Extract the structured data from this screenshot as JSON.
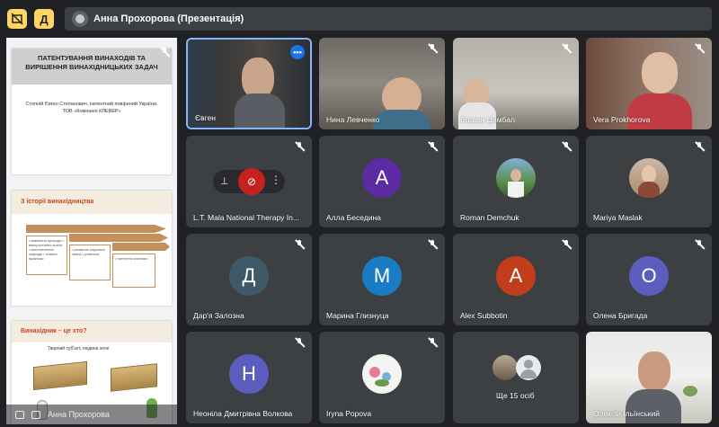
{
  "topbar": {
    "btn1_icon": "present-off-icon",
    "btn2_label": "Д",
    "presenter_name": "Анна Прохорова (Презентація)"
  },
  "presentation": {
    "slide1": {
      "title": "ПАТЕНТУВАННЯ ВИНАХОДІВ ТА ВИРІШЕННЯ ВИНАХІДНИЦЬКИХ ЗАДАЧ",
      "author": "Стопній Євген Степанович, патентний повірений України, ТОВ «Компанія КЛЕВЕР»"
    },
    "slide2": {
      "title": "З історії винахідництва",
      "box1": "• вивчення природи • використання вогню • виготовлення знарядь • знання практики",
      "box2": "• розвиток наукових знань • ремесла",
      "box3": "• патентна система"
    },
    "slide3": {
      "title": "Винахідник – це хто?",
      "subtitle": "Творчий суб'єкт, людина хоче"
    },
    "footer_name": "Анна Прохорова"
  },
  "tiles": [
    {
      "name": "Євген",
      "muted": false,
      "kind": "video"
    },
    {
      "name": "Нина Левченко",
      "muted": true,
      "kind": "video"
    },
    {
      "name": "Богдан Цимбал",
      "muted": true,
      "kind": "video"
    },
    {
      "name": "Vera Prokhorova",
      "muted": true,
      "kind": "video"
    },
    {
      "name": "L.T. Mala National Therapy In...",
      "muted": true,
      "kind": "hover"
    },
    {
      "name": "Алла Беседина",
      "muted": true,
      "kind": "letter",
      "letter": "A",
      "color": "#5b2ba3"
    },
    {
      "name": "Roman Demchuk",
      "muted": true,
      "kind": "photo"
    },
    {
      "name": "Mariya Maslak",
      "muted": true,
      "kind": "photo"
    },
    {
      "name": "Дар'я Залозна",
      "muted": true,
      "kind": "letter",
      "letter": "Д",
      "color": "#3f5968"
    },
    {
      "name": "Марина Глизнуца",
      "muted": true,
      "kind": "letter",
      "letter": "M",
      "color": "#1a7cc4"
    },
    {
      "name": "Alex Subbotin",
      "muted": true,
      "kind": "letter",
      "letter": "A",
      "color": "#c13d1b"
    },
    {
      "name": "Олена Бригада",
      "muted": true,
      "kind": "letter",
      "letter": "O",
      "color": "#5b5dbf"
    },
    {
      "name": "Неоніла Дмитрівна Волкова",
      "muted": true,
      "kind": "letter",
      "letter": "H",
      "color": "#5b5dbf"
    },
    {
      "name": "Iryna Popova",
      "muted": true,
      "kind": "photo"
    },
    {
      "name": "Ще 15 осіб",
      "muted": false,
      "kind": "more"
    },
    {
      "name": "Олексій Ільїнський",
      "muted": false,
      "kind": "video"
    }
  ],
  "colors": {
    "background": "#202124",
    "tile": "#3c4043",
    "accent_yellow": "#fdd663",
    "selected_border": "#8ab4f8",
    "mute_red": "#c5221f"
  }
}
